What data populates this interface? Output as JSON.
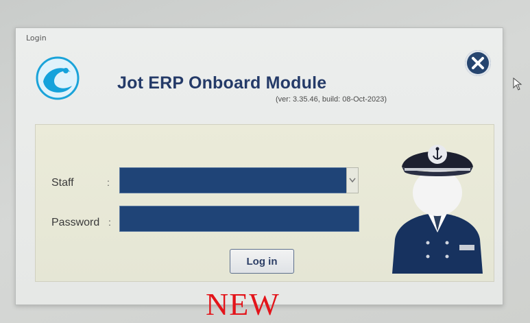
{
  "window": {
    "title": "Login",
    "app_title": "Jot ERP Onboard Module",
    "version": "(ver: 3.35.46, build: 08-Oct-2023)"
  },
  "form": {
    "staff_label": "Staff",
    "password_label": "Password",
    "colon": ":",
    "staff_value": "",
    "password_value": "",
    "login_button": "Log in"
  },
  "overlay": {
    "stamp_text": "NEW"
  },
  "colors": {
    "field_fill": "#1f4477",
    "title_text": "#243a68",
    "close_button": "#26456f",
    "stamp": "#e3141a"
  },
  "icons": {
    "logo": "wave-circle-logo",
    "close": "close-icon",
    "mascot": "ship-captain-figure",
    "cursor": "mouse-pointer-icon"
  }
}
